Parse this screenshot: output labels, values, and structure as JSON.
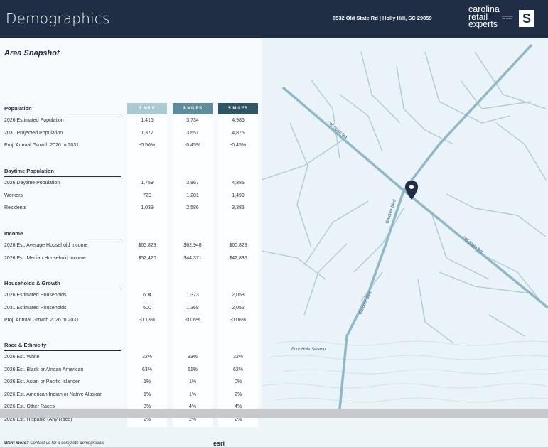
{
  "header": {
    "title": "Demographics",
    "address": "8532 Old State Rd | Holly Hill, SC 29059",
    "logo_lines": [
      "carolina",
      "retail",
      "experts"
    ],
    "logo_tagline": "commercial real estate",
    "logo_mark": "S"
  },
  "snapshot": {
    "heading": "Area Snapshot",
    "columns": [
      "1 MILE",
      "3 MILES",
      "5 MILES"
    ],
    "sections": [
      {
        "title": "Population",
        "rows": [
          {
            "label": "2026 Estimated Population",
            "values": [
              "1,416",
              "3,734",
              "4,986"
            ]
          },
          {
            "label": "2031 Projected Population",
            "values": [
              "1,377",
              "3,651",
              "4,875"
            ]
          },
          {
            "label": "Proj. Annual Growth 2026 to 2031",
            "values": [
              "-0.56%",
              "-0.45%",
              "-0.45%"
            ]
          }
        ]
      },
      {
        "title": "Daytime Population",
        "rows": [
          {
            "label": "2026 Daytime Population",
            "values": [
              "1,759",
              "3,867",
              "4,885"
            ]
          },
          {
            "label": "Workers",
            "values": [
              "720",
              "1,281",
              "1,499"
            ]
          },
          {
            "label": "Residents",
            "values": [
              "1,039",
              "2,586",
              "3,386"
            ]
          }
        ]
      },
      {
        "title": "Income",
        "rows": [
          {
            "label": "2026 Est. Average Household Income",
            "values": [
              "$65,823",
              "$62,948",
              "$60,823"
            ]
          },
          {
            "label": "2026 Est. Median Household Income",
            "values": [
              "$52,420",
              "$44,371",
              "$42,836"
            ]
          }
        ]
      },
      {
        "title": "Households & Growth",
        "rows": [
          {
            "label": "2026 Estimated Households",
            "values": [
              "604",
              "1,373",
              "2,058"
            ]
          },
          {
            "label": "2031 Estimated Households",
            "values": [
              "600",
              "1,368",
              "2,052"
            ]
          },
          {
            "label": "Proj. Annual Growth 2026 to 2031",
            "values": [
              "-0.13%",
              "-0.06%",
              "-0.06%"
            ]
          }
        ]
      },
      {
        "title": "Race & Ethnicity",
        "rows": [
          {
            "label": "2026 Est. White",
            "values": [
              "32%",
              "33%",
              "32%"
            ]
          },
          {
            "label": "2026 Est. Black or African American",
            "values": [
              "63%",
              "61%",
              "62%"
            ]
          },
          {
            "label": "2026 Est. Asian or Pacific Islander",
            "values": [
              "1%",
              "1%",
              "0%"
            ]
          },
          {
            "label": "2026 Est. American Indian or Native Alaskan",
            "values": [
              "1%",
              "1%",
              "2%"
            ]
          },
          {
            "label": "2026 Est. Other Races",
            "values": [
              "3%",
              "4%",
              "4%"
            ]
          },
          {
            "label": "2026 Est. Hispanic (Any Race)",
            "values": [
              "2%",
              "2%",
              "2%"
            ]
          }
        ]
      }
    ],
    "footer_bold": "Want more?",
    "footer_text": " Contact us for a complete demographic",
    "esri": "esri"
  },
  "map": {
    "road_labels": [
      "Old State Rd",
      "Old State Rd",
      "Gardner Blvd",
      "Gardner Blvd",
      "Four Hole Swamp"
    ],
    "colors": {
      "road": "#8fb8c8",
      "minor": "#aecbd6",
      "pin": "#1f2d45",
      "water": "#c6dde6"
    }
  },
  "colors": {
    "header": "#1f2d45",
    "col1": "#a9c9d3",
    "col2": "#5d8c9c",
    "col3": "#2e5566"
  }
}
